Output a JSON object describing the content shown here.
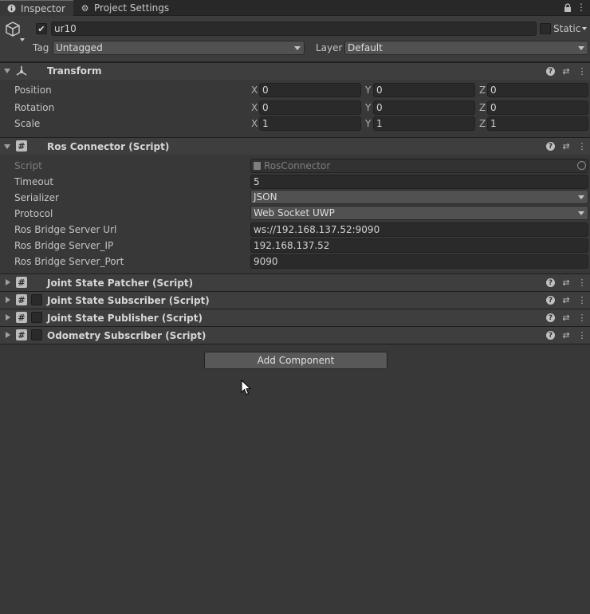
{
  "tabs": [
    {
      "label": "Inspector",
      "icon": "info-icon"
    },
    {
      "label": "Project Settings",
      "icon": "gear-icon"
    }
  ],
  "header": {
    "object_name": "ur10",
    "active": true,
    "static_label": "Static",
    "tag_label": "Tag",
    "tag_value": "Untagged",
    "layer_label": "Layer",
    "layer_value": "Default"
  },
  "transform": {
    "title": "Transform",
    "rows": [
      {
        "label": "Position",
        "x": "0",
        "y": "0",
        "z": "0"
      },
      {
        "label": "Rotation",
        "x": "0",
        "y": "0",
        "z": "0"
      },
      {
        "label": "Scale",
        "x": "1",
        "y": "1",
        "z": "1"
      }
    ],
    "axis_labels": [
      "X",
      "Y",
      "Z"
    ]
  },
  "ros_connector": {
    "title": "Ros Connector (Script)",
    "script_label": "Script",
    "script_value": "RosConnector",
    "fields": [
      {
        "label": "Timeout",
        "value": "5",
        "kind": "field"
      },
      {
        "label": "Serializer",
        "value": "JSON",
        "kind": "dropdown"
      },
      {
        "label": "Protocol",
        "value": "Web Socket UWP",
        "kind": "dropdown"
      },
      {
        "label": "Ros Bridge Server Url",
        "value": "ws://192.168.137.52:9090",
        "kind": "field"
      },
      {
        "label": "Ros Bridge Server_IP",
        "value": "192.168.137.52",
        "kind": "field"
      },
      {
        "label": "Ros Bridge Server_Port",
        "value": "9090",
        "kind": "field"
      }
    ]
  },
  "collapsed_components": [
    {
      "title": "Joint State Patcher (Script)",
      "has_checkbox": false
    },
    {
      "title": "Joint State Subscriber (Script)",
      "has_checkbox": true
    },
    {
      "title": "Joint State Publisher (Script)",
      "has_checkbox": true
    },
    {
      "title": "Odometry Subscriber (Script)",
      "has_checkbox": true
    }
  ],
  "add_component_label": "Add Component"
}
